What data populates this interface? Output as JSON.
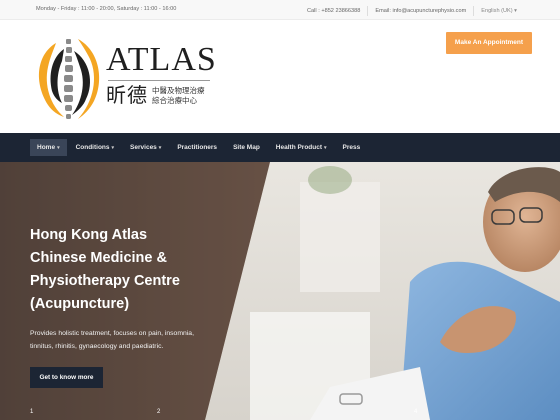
{
  "topbar": {
    "hours": "Monday - Friday : 11:00 - 20:00, Saturday : 11:00 - 16:00",
    "call": "Call : +852 23866388",
    "email": "Email: info@acupuncturephysio.com",
    "language": "English (UK) ▾"
  },
  "header": {
    "logo_word": "ATLAS",
    "logo_cn_big": "昕德",
    "logo_cn_line1": "中醫及物理治療",
    "logo_cn_line2": "綜合治療中心",
    "cta_label": "Make An Appointment"
  },
  "nav": {
    "items": [
      {
        "label": "Home",
        "has_dropdown": true,
        "active": true
      },
      {
        "label": "Conditions",
        "has_dropdown": true,
        "active": false
      },
      {
        "label": "Services",
        "has_dropdown": true,
        "active": false
      },
      {
        "label": "Practitioners",
        "has_dropdown": false,
        "active": false
      },
      {
        "label": "Site Map",
        "has_dropdown": false,
        "active": false
      },
      {
        "label": "Health Product",
        "has_dropdown": true,
        "active": false
      },
      {
        "label": "Press",
        "has_dropdown": false,
        "active": false
      }
    ],
    "caret": "▾"
  },
  "hero": {
    "title_lines": [
      "Hong Kong Atlas",
      "Chinese Medicine &",
      "Physiotherapy Centre",
      "(Acupuncture)"
    ],
    "description": "Provides holistic treatment, focuses on pain, insomnia, tinnitus, rhinitis, gynaecology and paediatric.",
    "button_label": "Get to know more",
    "pager": [
      "1",
      "2",
      "4"
    ]
  },
  "colors": {
    "accent": "#f5a04c",
    "nav_bg": "#1c2534",
    "logo_orange": "#f4a623"
  }
}
